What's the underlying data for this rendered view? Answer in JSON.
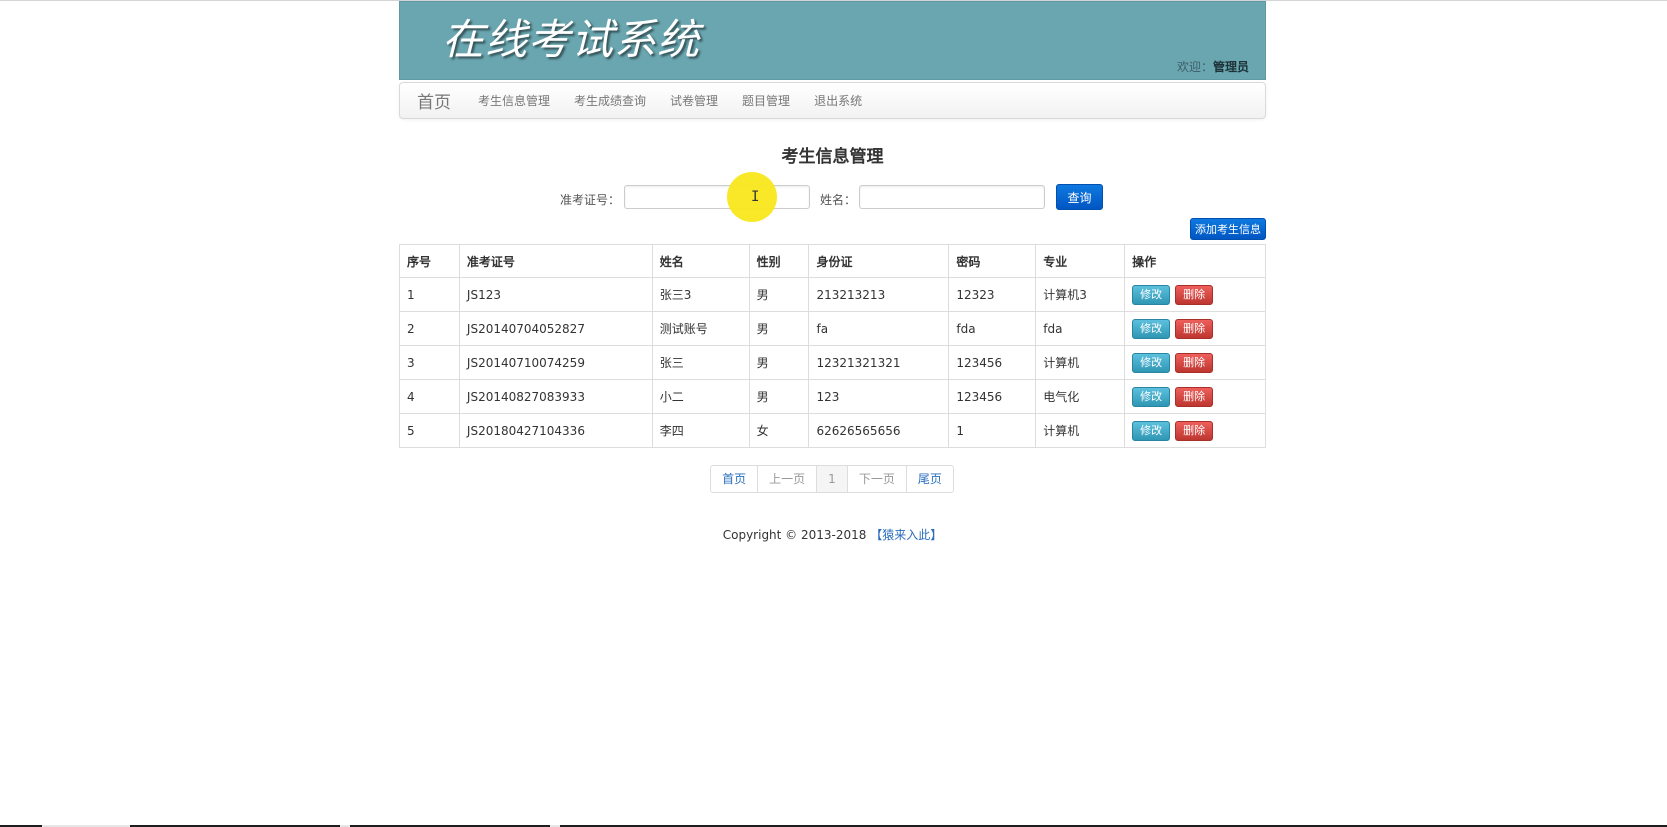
{
  "header": {
    "title": "在线考试系统",
    "welcome_label": "欢迎：",
    "user_name": "管理员"
  },
  "nav": {
    "brand": "首页",
    "items": [
      {
        "label": "考生信息管理"
      },
      {
        "label": "考生成绩查询"
      },
      {
        "label": "试卷管理"
      },
      {
        "label": "题目管理"
      },
      {
        "label": "退出系统"
      }
    ]
  },
  "page": {
    "title": "考生信息管理"
  },
  "search": {
    "ticket_label": "准考证号：",
    "ticket_value": "",
    "name_label": "姓名：",
    "name_value": "",
    "submit_label": "查询"
  },
  "add_button_label": "添加考生信息",
  "table": {
    "headers": [
      "序号",
      "准考证号",
      "姓名",
      "性别",
      "身份证",
      "密码",
      "专业",
      "操作"
    ],
    "edit_label": "修改",
    "delete_label": "删除",
    "rows": [
      {
        "index": "1",
        "ticket": "JS123",
        "name": "张三3",
        "gender": "男",
        "id_card": "213213213",
        "password": "12323",
        "major": "计算机3"
      },
      {
        "index": "2",
        "ticket": "JS20140704052827",
        "name": "测试账号",
        "gender": "男",
        "id_card": "fa",
        "password": "fda",
        "major": "fda"
      },
      {
        "index": "3",
        "ticket": "JS20140710074259",
        "name": "张三",
        "gender": "男",
        "id_card": "12321321321",
        "password": "123456",
        "major": "计算机"
      },
      {
        "index": "4",
        "ticket": "JS20140827083933",
        "name": "小二",
        "gender": "男",
        "id_card": "123",
        "password": "123456",
        "major": "电气化"
      },
      {
        "index": "5",
        "ticket": "JS20180427104336",
        "name": "李四",
        "gender": "女",
        "id_card": "62626565656",
        "password": "1",
        "major": "计算机"
      }
    ]
  },
  "pagination": {
    "first": "首页",
    "prev": "上一页",
    "current": "1",
    "next": "下一页",
    "last": "尾页"
  },
  "footer": {
    "copyright": "Copyright © 2013-2018",
    "link": "【猿来入此】"
  },
  "colors": {
    "banner": "#6aa6b0",
    "primary": "#0056c2",
    "info": "#2f96b4",
    "danger": "#bd362f",
    "cursor_highlight": "#f8e71c"
  }
}
